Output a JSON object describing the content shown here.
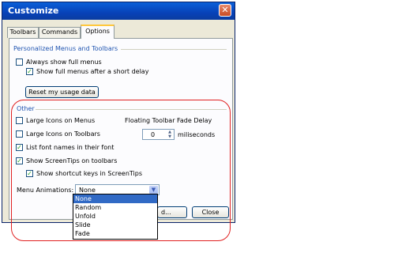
{
  "window": {
    "title": "Customize"
  },
  "tabs": [
    "Toolbars",
    "Commands",
    "Options"
  ],
  "personalized": {
    "title": "Personalized Menus and Toolbars",
    "always_full_menus": {
      "label": "Always show full menus",
      "checked": false
    },
    "full_menus_after_delay": {
      "label": "Show full menus after a short delay",
      "checked": true
    },
    "reset_button": "Reset my usage data"
  },
  "other": {
    "title": "Other",
    "large_icons_menus": {
      "label": "Large Icons on Menus",
      "checked": false
    },
    "large_icons_toolbars": {
      "label": "Large Icons on Toolbars",
      "checked": false
    },
    "list_font_names": {
      "label": "List font names in their font",
      "checked": true
    },
    "show_screentips": {
      "label": "Show ScreenTips on toolbars",
      "checked": true
    },
    "show_shortcut_keys": {
      "label": "Show shortcut keys in ScreenTips",
      "checked": true
    },
    "fade_delay_label": "Floating Toolbar Fade Delay",
    "fade_delay_value": "0",
    "fade_delay_unit": "miliseconds",
    "menu_animations_label": "Menu Animations:",
    "menu_animations_value": "None",
    "menu_animations_options": [
      "None",
      "Random",
      "Unfold",
      "Slide",
      "Fade"
    ]
  },
  "footer": {
    "partial_button": "d...",
    "close_button": "Close"
  }
}
